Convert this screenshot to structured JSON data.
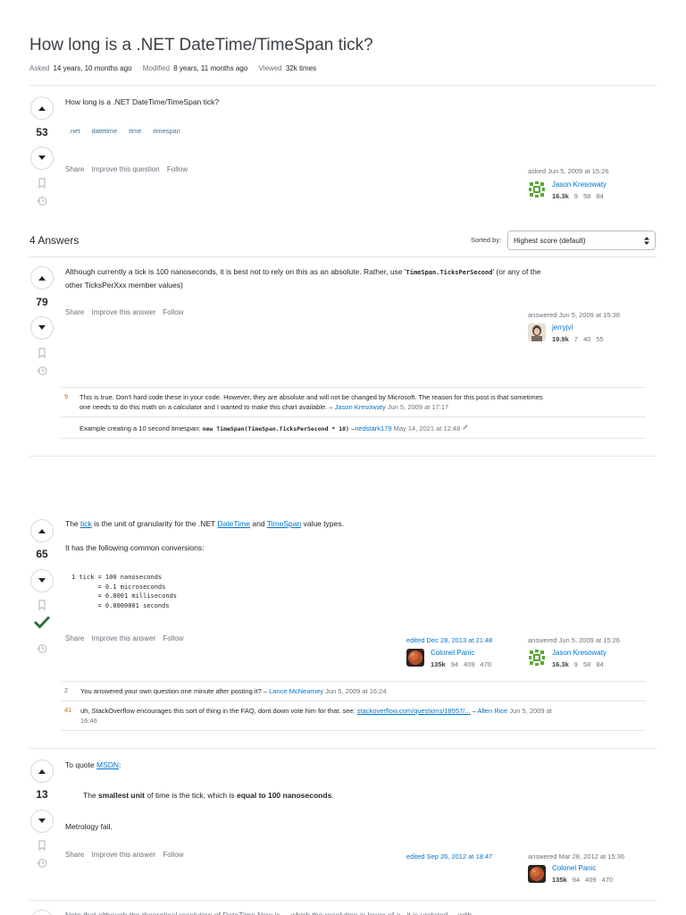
{
  "question": {
    "title": "How long is a .NET DateTime/TimeSpan tick?",
    "asked_label": "Asked",
    "asked_value": "14 years, 10 months ago",
    "modified_label": "Modified",
    "modified_value": "8 years, 11 months ago",
    "viewed_label": "Viewed",
    "viewed_value": "32k times",
    "votes": "53",
    "body": "How long is a .NET DateTime/TimeSpan tick?",
    "tags": [
      ".net",
      "datetime",
      "time",
      "timespan"
    ],
    "actions": [
      "Share",
      "Improve this question",
      "Follow"
    ],
    "signer": {
      "time": "asked Jun 5, 2009 at 15:26",
      "name": "Jason Kresowaty",
      "rep": "16.3k",
      "gold": "9",
      "silver": "58",
      "bronze": "84"
    }
  },
  "answers_header": {
    "count": "4 Answers",
    "sorted_by": "Sorted by:",
    "sort_value": "Highest score (default)"
  },
  "answers": [
    {
      "votes": "79",
      "body_1": "Although currently a tick is 100 nanoseconds, it is best not to rely on this as an absolute. Rather, use '",
      "body_code": "TimeSpan.TicksPerSecond",
      "body_2": "' (or any of the",
      "body_line2": "other TicksPerXxx member values)",
      "actions": [
        "Share",
        "Improve this answer",
        "Follow"
      ],
      "signer": {
        "time": "answered Jun 5, 2009 at 15:38",
        "name": "jerryjvl",
        "rep": "19.9k",
        "gold": "7",
        "silver": "40",
        "bronze": "55"
      },
      "comments": [
        {
          "score": "9",
          "line1": "This is true. Don't hard code these in your code. However, they are absolute and will not be changed by Microsoft. The reason for this post is that sometimes",
          "line2": "one needs to do this math on a calculator and I wanted to make this chart available. –",
          "user": "Jason Kresowaty",
          "time": "Jun 5, 2009 at 17:17"
        },
        {
          "score": "",
          "text": "Example creating a 10 second timespan:",
          "code": "new TimeSpan(TimeSpan.TicksPerSecond * 10)",
          "dash": "–",
          "user": "nedstark179",
          "time": "May 14, 2021 at 12:48"
        }
      ]
    },
    {
      "votes": "65",
      "p1_a": "The",
      "p1_link1": "tick",
      "p1_b": "is the unit of granularity for the .NET",
      "p1_link2": "DateTime",
      "p1_c": "and",
      "p1_link3": "TimeSpan",
      "p1_d": "value types.",
      "p2": "It has the following common conversions:",
      "pre": "1 tick = 100 nanoseconds\n       = 0.1 microseconds\n       = 0.0001 milliseconds\n       = 0.0000001 seconds",
      "actions": [
        "Share",
        "Improve this answer",
        "Follow"
      ],
      "editor": {
        "time": "edited Dec 28, 2013 at 21:48",
        "name": "Colonel Panic",
        "rep": "135k",
        "gold": "94",
        "silver": "409",
        "bronze": "470"
      },
      "signer": {
        "time": "answered Jun 5, 2009 at 15:26",
        "name": "Jason Kresowaty",
        "rep": "16.3k",
        "gold": "9",
        "silver": "58",
        "bronze": "84"
      },
      "comments": [
        {
          "score": "2",
          "text": "You answered your own question one minute after posting it? –",
          "user": "Lance McNearney",
          "time": "Jun 5, 2009 at 16:24"
        },
        {
          "score": "41",
          "text": "uh, StackOverflow encourages this sort of thing in the FAQ, dont down vote him for that. see:",
          "link": "stackoverflow.com/questions/18557/...",
          "dash": "–",
          "user": "Allen Rice",
          "time": "Jun 5, 2009 at",
          "time2": "16:46"
        }
      ]
    },
    {
      "votes": "13",
      "p1_a": "To quote",
      "p1_link": "MSDN",
      "p1_b": ":",
      "quote_a": "The",
      "quote_b": "smallest unit",
      "quote_c": "of time is the tick, which is",
      "quote_d": "equal to 100 nanoseconds",
      "quote_e": ".",
      "p2": "Metrology fail.",
      "actions": [
        "Share",
        "Improve this answer",
        "Follow"
      ],
      "editor": {
        "time": "edited Sep 26, 2012 at 18:47"
      },
      "signer": {
        "time": "answered Mar 28, 2012 at 15:36",
        "name": "Colonel Panic",
        "rep": "135k",
        "gold": "94",
        "silver": "409",
        "bronze": "470"
      }
    }
  ],
  "fourth_answer_snippet": "Note that although the theoretical resolution of DateTime.Now is ... which the resolution is lower of a . it is updated ... with ..."
}
